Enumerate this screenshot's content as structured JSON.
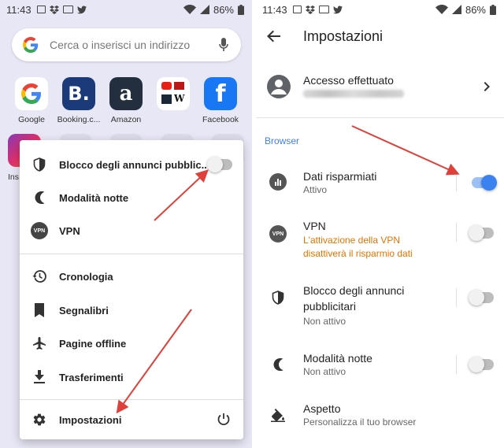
{
  "left": {
    "status": {
      "time": "11:43",
      "battery": "86%"
    },
    "search": {
      "placeholder": "Cerca o inserisci un indirizzo"
    },
    "shortcuts": [
      {
        "label": "Google"
      },
      {
        "label": "Booking.c..."
      },
      {
        "label": "Amazon"
      },
      {
        "label": ""
      },
      {
        "label": "Facebook"
      }
    ],
    "instagram_label": "Ins",
    "menu": {
      "adblock": "Blocco degli annunci pubblic..",
      "night": "Modalità notte",
      "vpn": "VPN",
      "history": "Cronologia",
      "bookmarks": "Segnalibri",
      "offline": "Pagine offline",
      "downloads": "Trasferimenti",
      "settings": "Impostazioni",
      "vpn_badge": "VPN"
    }
  },
  "right": {
    "status": {
      "time": "11:43",
      "battery": "86%"
    },
    "title": "Impostazioni",
    "account": {
      "title": "Accesso effettuato"
    },
    "section": "Browser",
    "rows": {
      "data_saver": {
        "title": "Dati risparmiati",
        "sub": "Attivo"
      },
      "vpn": {
        "title": "VPN",
        "sub1": "L'attivazione della VPN",
        "sub2": "disattiverà il risparmio dati"
      },
      "adblock": {
        "title1": "Blocco degli annunci",
        "title2": "pubblicitari",
        "sub": "Non attivo"
      },
      "night": {
        "title": "Modalità notte",
        "sub": "Non attivo"
      },
      "theme": {
        "title": "Aspetto",
        "sub": "Personalizza il tuo browser"
      }
    },
    "vpn_badge": "VPN"
  },
  "colors": {
    "accent": "#3b82f0",
    "warning": "#e37400",
    "arrow": "#e0403a",
    "left_bg": "#e8e7f5"
  },
  "toggles": {
    "left_adblock": false,
    "data_saver": true,
    "vpn": false,
    "adblock": false,
    "night": false
  }
}
